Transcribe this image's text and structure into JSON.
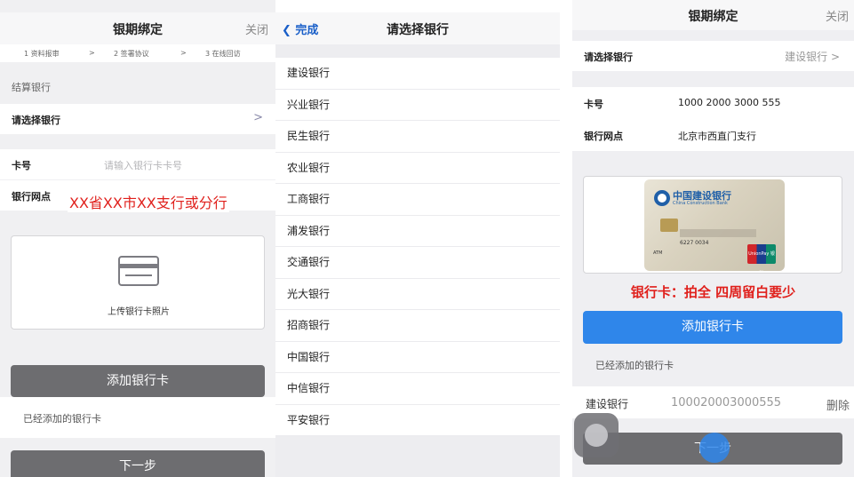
{
  "panel1": {
    "nav": {
      "title": "银期绑定",
      "close": "关闭"
    },
    "steps": {
      "step1": "1 资料报审",
      "sep1": ">",
      "step2": "2 签署协议",
      "sep2": ">",
      "step3": "3 在线回访"
    },
    "section_label": "结算银行",
    "select_bank": {
      "label": "请选择银行",
      "chevron": ">"
    },
    "card_no": {
      "label": "卡号",
      "placeholder": "请输入银行卡卡号"
    },
    "branch": {
      "label": "银行网点"
    },
    "branch_annotation": "XX省XX市XX支行或分行",
    "upload": {
      "text": "上传银行卡照片",
      "icon": "credit-card-icon"
    },
    "add_button": "添加银行卡",
    "added_label": "已经添加的银行卡",
    "next_button": "下一步"
  },
  "panel2": {
    "nav": {
      "back": "❮ 完成",
      "title": "请选择银行"
    },
    "banks": [
      "建设银行",
      "兴业银行",
      "民生银行",
      "农业银行",
      "工商银行",
      "浦发银行",
      "交通银行",
      "光大银行",
      "招商银行",
      "中国银行",
      "中信银行",
      "平安银行"
    ]
  },
  "panel3": {
    "nav": {
      "title": "银期绑定",
      "close": "关闭"
    },
    "select_bank": {
      "label": "请选择银行",
      "value": "建设银行 >"
    },
    "card_no": {
      "label": "卡号",
      "value": "1000 2000 3000 555"
    },
    "branch": {
      "label": "银行网点",
      "value": "北京市西直门支行"
    },
    "card_photo": {
      "bank_name": "中国建设银行",
      "bank_name_en": "China Construction Bank",
      "number_text": "6227 0034",
      "atm": "ATM",
      "unionpay": "UnionPay 银联"
    },
    "annotation": "银行卡：拍全 四周留白要少",
    "add_button": "添加银行卡",
    "added_label": "已经添加的银行卡",
    "added_card": {
      "bank": "建设银行",
      "number": "100020003000555",
      "delete": "删除"
    },
    "next_button": "下一步"
  },
  "colors": {
    "accent_blue": "#2f86ea",
    "link_blue": "#1a5fc8",
    "annotation_red": "#e0201c",
    "button_gray": "#6d6d70"
  }
}
